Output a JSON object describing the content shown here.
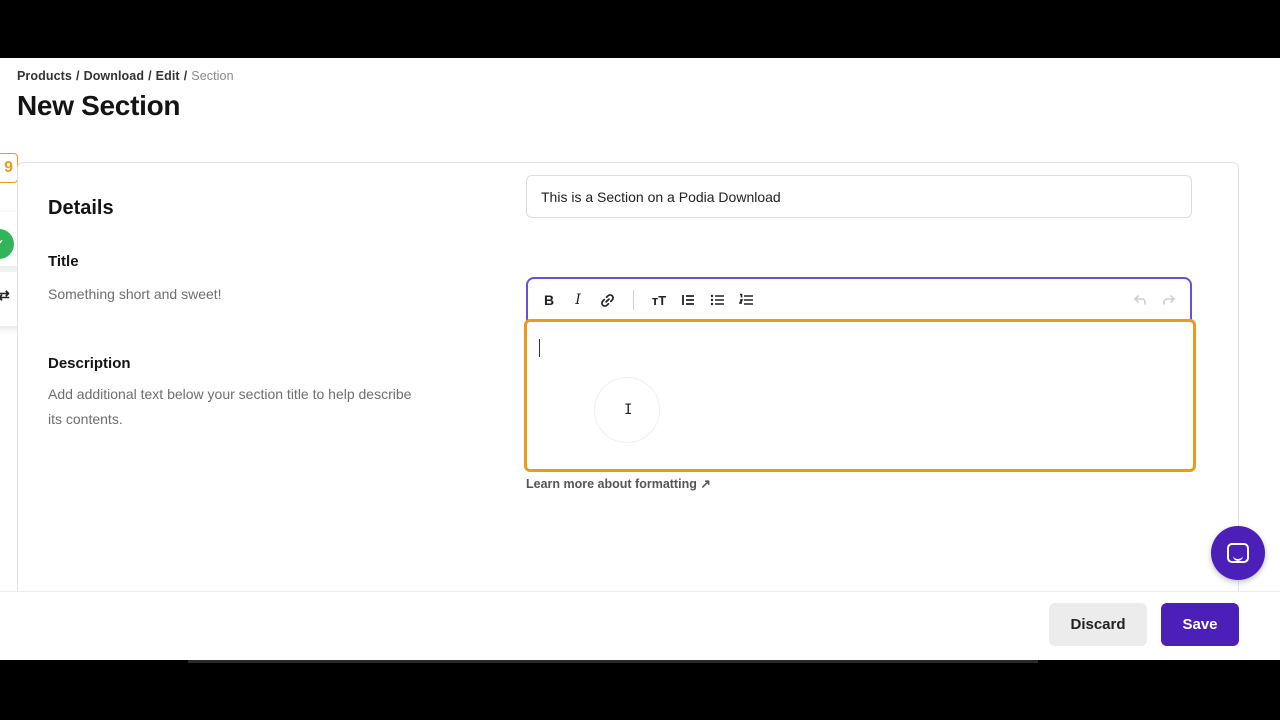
{
  "breadcrumb": {
    "items": [
      "Products",
      "Download",
      "Edit"
    ],
    "current": "Section"
  },
  "page": {
    "title": "New Section"
  },
  "details": {
    "heading": "Details",
    "title_field": {
      "label": "Title",
      "help": "Something short and sweet!",
      "value": "This is a Section on a Podia Download"
    },
    "description_field": {
      "label": "Description",
      "help": "Add additional text below your section title to help describe its contents.",
      "value": ""
    },
    "learn_more": "Learn more about formatting ↗"
  },
  "toolbar": {
    "bold": "B",
    "italic": "I",
    "heading": "ᴛT"
  },
  "side": {
    "badge": "9"
  },
  "footer": {
    "discard_label": "Discard",
    "save_label": "Save"
  },
  "colors": {
    "accent": "#4b1fb8",
    "focus_outline": "#e99b1f",
    "success": "#32b55a"
  }
}
